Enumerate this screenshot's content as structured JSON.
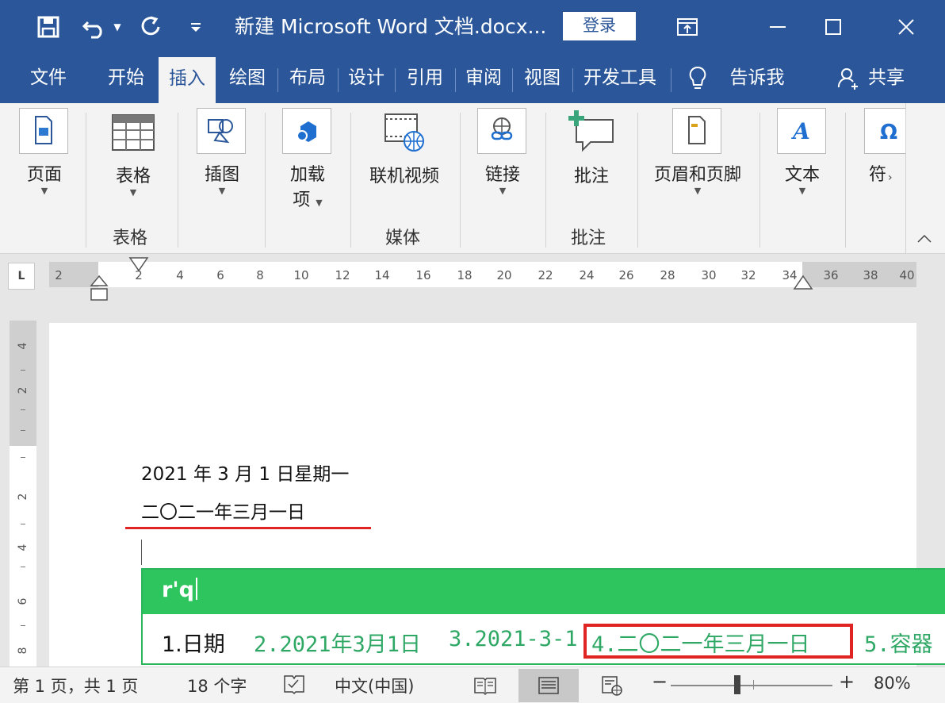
{
  "titlebar": {
    "doc_title": "新建 Microsoft Word 文档.docx...",
    "login_label": "登录",
    "colors": {
      "bar": "#2b579a",
      "text": "#ffffff"
    }
  },
  "tabs": [
    {
      "label": "文件",
      "active": false
    },
    {
      "label": "开始",
      "active": false
    },
    {
      "label": "插入",
      "active": true
    },
    {
      "label": "绘图",
      "active": false
    },
    {
      "label": "布局",
      "active": false
    },
    {
      "label": "设计",
      "active": false
    },
    {
      "label": "引用",
      "active": false
    },
    {
      "label": "审阅",
      "active": false
    },
    {
      "label": "视图",
      "active": false
    },
    {
      "label": "开发工具",
      "active": false
    },
    {
      "label": "告诉我",
      "active": false
    },
    {
      "label": "共享",
      "active": false
    }
  ],
  "ribbon": {
    "pages": "页面",
    "table": "表格",
    "illustrations": "插图",
    "addins_line1": "加载",
    "addins_line2": "项",
    "online_video": "联机视频",
    "links": "链接",
    "comment": "批注",
    "header_footer": "页眉和页脚",
    "text": "文本",
    "symbols": "符",
    "groups": {
      "table": "表格",
      "media": "媒体",
      "comments": "批注"
    }
  },
  "ruler": {
    "tabstop_glyph": "L",
    "ticks": [
      "2",
      "2",
      "4",
      "6",
      "8",
      "10",
      "12",
      "14",
      "16",
      "18",
      "20",
      "22",
      "24",
      "26",
      "28",
      "30",
      "32",
      "34",
      "36",
      "38",
      "40"
    ],
    "vticks": [
      "4",
      "2",
      "2",
      "4",
      "6",
      "8"
    ]
  },
  "document": {
    "line1": "2021 年 3 月 1 日星期一",
    "line2": "二〇二一年三月一日"
  },
  "ime": {
    "input": "r'q",
    "candidates": [
      {
        "text": "1.日期"
      },
      {
        "text": "2.2021年3月1日"
      },
      {
        "text": "3.2021-3-1"
      },
      {
        "text": "4.二〇二一年三月一日"
      },
      {
        "text": "5.容器"
      }
    ],
    "highlighted_index": 4,
    "colors": {
      "bar": "#2ec55f",
      "candidate": "#2fa866",
      "highlight": "#e02424"
    }
  },
  "status": {
    "page": "第 1 页，共 1 页",
    "words": "18 个字",
    "language": "中文(中国)",
    "zoom": "80%",
    "zoom_minus": "−",
    "zoom_plus": "+"
  }
}
